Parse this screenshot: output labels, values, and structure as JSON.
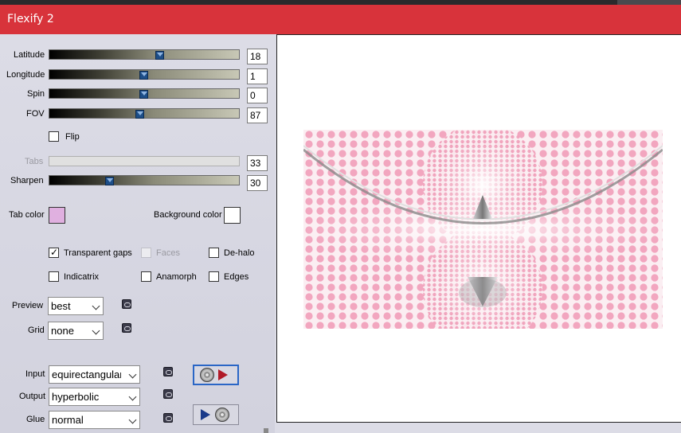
{
  "window": {
    "title": "Flexify 2"
  },
  "sliders": {
    "latitude": {
      "label": "Latitude",
      "value": "18",
      "fraction": 0.59
    },
    "longitude": {
      "label": "Longitude",
      "value": "1",
      "fraction": 0.5
    },
    "spin": {
      "label": "Spin",
      "value": "0",
      "fraction": 0.5
    },
    "fov": {
      "label": "FOV",
      "value": "87",
      "fraction": 0.48
    },
    "tabs": {
      "label": "Tabs",
      "value": "33"
    },
    "sharpen": {
      "label": "Sharpen",
      "value": "30",
      "fraction": 0.31
    }
  },
  "flip": {
    "label": "Flip",
    "checked": false
  },
  "colors": {
    "tab_color_label": "Tab color",
    "tab_color": "#e0b0e0",
    "background_color_label": "Background color",
    "background_color": "#ffffff",
    "accent": "#d8333b"
  },
  "options": {
    "transparent_gaps": {
      "label": "Transparent gaps",
      "checked": true
    },
    "faces": {
      "label": "Faces",
      "checked": false
    },
    "de_halo": {
      "label": "De-halo",
      "checked": false
    },
    "indicatrix": {
      "label": "Indicatrix",
      "checked": false
    },
    "anamorph": {
      "label": "Anamorph",
      "checked": false
    },
    "edges": {
      "label": "Edges",
      "checked": false
    }
  },
  "preview_quality": {
    "label": "Preview",
    "value": "best"
  },
  "grid": {
    "label": "Grid",
    "value": "none"
  },
  "projection": {
    "input_label": "Input",
    "input_value": "equirectangular",
    "output_label": "Output",
    "output_value": "hyperbolic",
    "glue_label": "Glue",
    "glue_value": "normal"
  },
  "icons": {
    "link": "link-icon",
    "disc": "disc-icon",
    "play": "play-arrow-icon"
  }
}
